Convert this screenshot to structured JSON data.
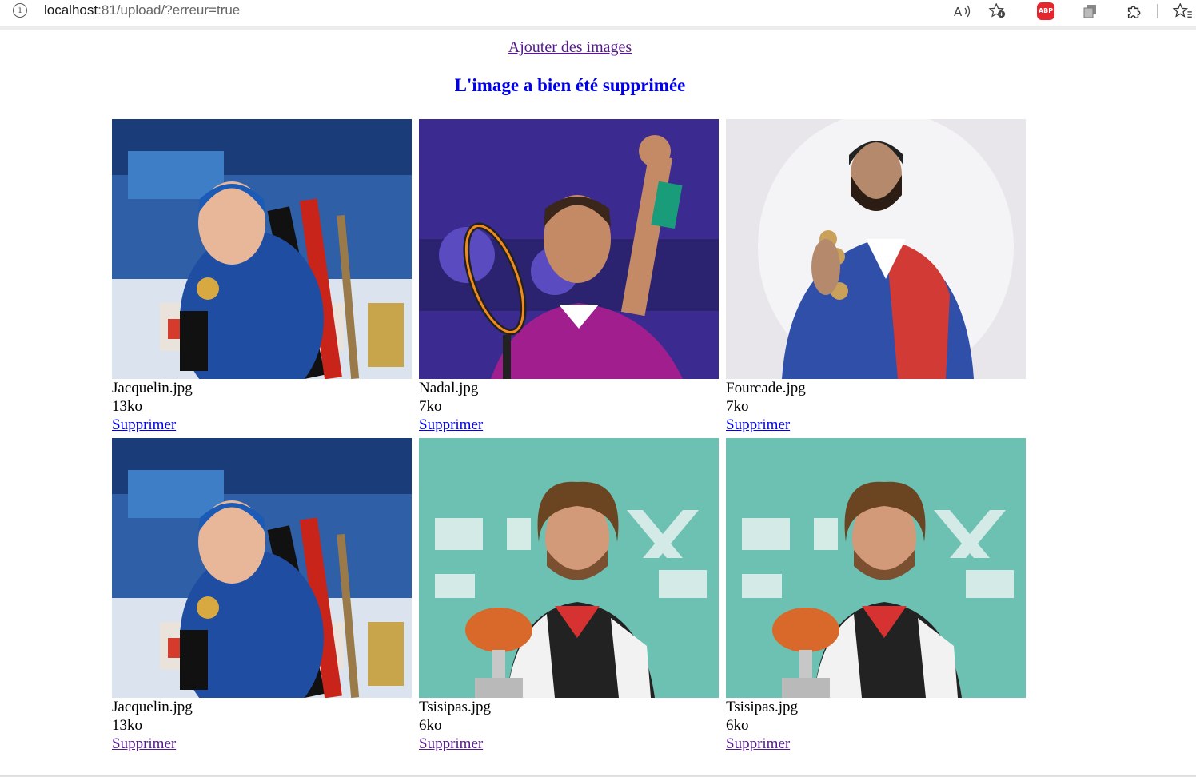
{
  "browser": {
    "url_host": "localhost",
    "url_rest": ":81/upload/?erreur=true",
    "info_icon": "info-icon",
    "read_aloud_icon": "read-aloud-icon",
    "favorite_add_icon": "favorite-add-icon",
    "adblock_label": "ABP",
    "collections_icon": "collections-icon",
    "extensions_icon": "puzzle-icon",
    "favorites_icon": "favorites-icon"
  },
  "page": {
    "add_link": "Ajouter des images",
    "message": "L'image a bien été supprimée",
    "message_color": "#0000ee",
    "delete_label": "Supprimer"
  },
  "gallery": [
    {
      "filename": "Jacquelin.jpg",
      "size": "13ko",
      "delete": "Supprimer",
      "photo": "biathlete-blue"
    },
    {
      "filename": "Nadal.jpg",
      "size": "7ko",
      "delete": "Supprimer",
      "photo": "tennis-purple"
    },
    {
      "filename": "Fourcade.jpg",
      "size": "7ko",
      "delete": "Supprimer",
      "photo": "biathlete-medals"
    },
    {
      "filename": "Jacquelin.jpg",
      "size": "13ko",
      "delete": "Supprimer",
      "photo": "biathlete-blue"
    },
    {
      "filename": "Tsisipas.jpg",
      "size": "6ko",
      "delete": "Supprimer",
      "photo": "tennis-trophy"
    },
    {
      "filename": "Tsisipas.jpg",
      "size": "6ko",
      "delete": "Supprimer",
      "photo": "tennis-trophy"
    }
  ]
}
